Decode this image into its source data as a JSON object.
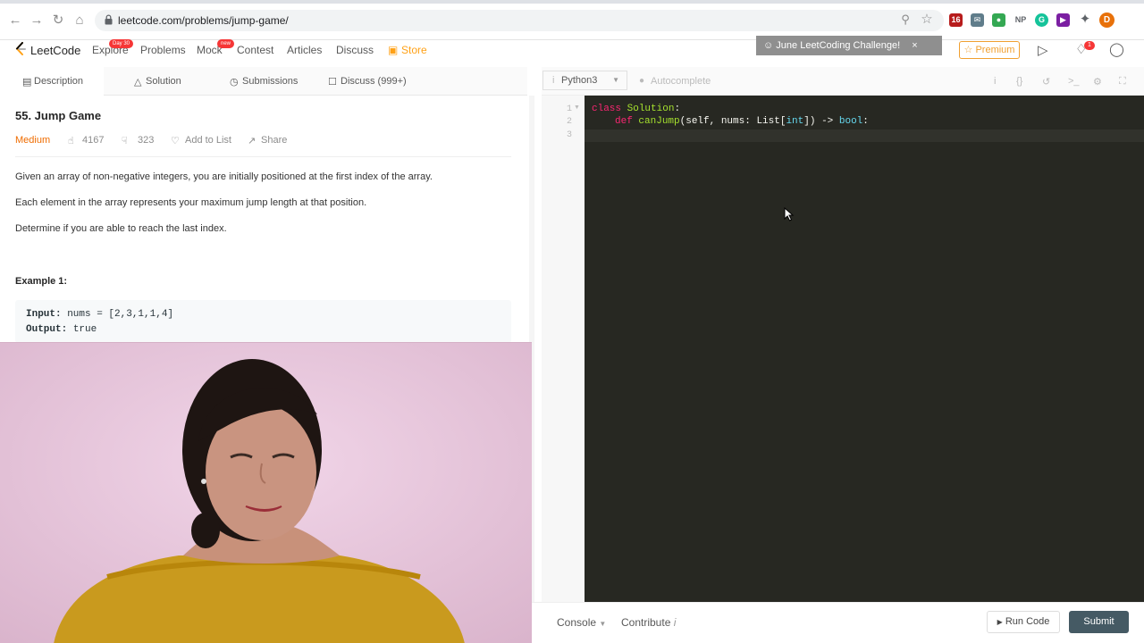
{
  "browser": {
    "url": "leetcode.com/problems/jump-game/",
    "ext_badge": "16",
    "ext_np": "NP",
    "profile_initial": "D"
  },
  "nav": {
    "logo": "LeetCode",
    "explore": "Explore",
    "explore_badge": "Day 30",
    "problems": "Problems",
    "mock": "Mock",
    "mock_badge": "new",
    "contest": "Contest",
    "articles": "Articles",
    "discuss": "Discuss",
    "store": "Store",
    "challenge_banner": "June LeetCoding Challenge!",
    "premium": "Premium",
    "notification_count": "1"
  },
  "tabs": {
    "description": "Description",
    "solution": "Solution",
    "submissions": "Submissions",
    "discuss": "Discuss (999+)"
  },
  "problem": {
    "title": "55. Jump Game",
    "difficulty": "Medium",
    "likes": "4167",
    "dislikes": "323",
    "add_to_list": "Add to List",
    "share": "Share",
    "para1": "Given an array of non-negative integers, you are initially positioned at the first index of the array.",
    "para2": "Each element in the array represents your maximum jump length at that position.",
    "para3": "Determine if you are able to reach the last index.",
    "example_title": "Example 1:",
    "input_label": "Input:",
    "input_value": " nums = [2,3,1,1,4]",
    "output_label": "Output:",
    "output_value": " true"
  },
  "editor": {
    "language": "Python3",
    "autocomplete": "Autocomplete",
    "line_numbers": [
      "1",
      "2",
      "3"
    ],
    "code": {
      "kw_class": "class",
      "class_name": " Solution",
      "colon1": ":",
      "kw_def": "def",
      "fn_name": " canJump",
      "params": "(self, nums: List[",
      "type_int": "int",
      "params_end": "]) -> ",
      "type_bool": "bool",
      "colon2": ":"
    }
  },
  "bottom": {
    "console": "Console",
    "contribute": "Contribute",
    "run_code": "Run Code",
    "submit": "Submit"
  },
  "colors": {
    "editor_bg": "#272822",
    "keyword": "#f92672",
    "class_name": "#a6e22e",
    "type": "#66d9ef",
    "difficulty": "#ef6c00",
    "submit_bg": "#455a64"
  }
}
